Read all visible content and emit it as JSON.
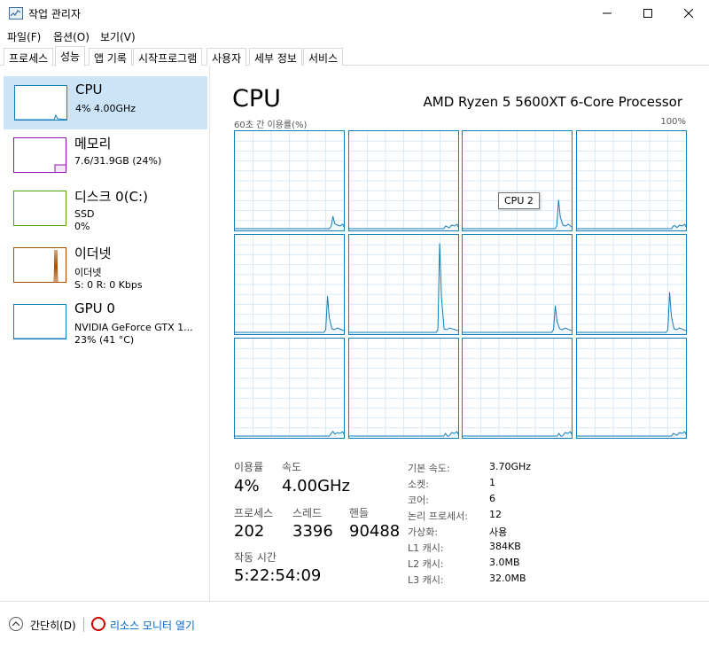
{
  "window": {
    "title": "작업 관리자"
  },
  "menu": [
    "파일(F)",
    "옵션(O)",
    "보기(V)"
  ],
  "tabs": [
    "프로세스",
    "성능",
    "앱 기록",
    "시작프로그램",
    "사용자",
    "세부 정보",
    "서비스"
  ],
  "active_tab": "성능",
  "sidebar": {
    "items": [
      {
        "title": "CPU",
        "line1": "4% 4.00GHz",
        "line2": "",
        "color": "#117dbb",
        "selected": true
      },
      {
        "title": "메모리",
        "line1": "7.6/31.9GB (24%)",
        "line2": "",
        "color": "#8b12ae",
        "selected": false
      },
      {
        "title": "디스크 0(C:)",
        "line1": "SSD",
        "line2": "0%",
        "color": "#4da60c",
        "selected": false
      },
      {
        "title": "이더넷",
        "line1": "이더넷",
        "line2": "S: 0 R: 0 Kbps",
        "color": "#a74f01",
        "selected": false
      },
      {
        "title": "GPU 0",
        "line1": "NVIDIA GeForce GTX 1...",
        "line2": "23% (41 °C)",
        "color": "#117dbb",
        "selected": false
      }
    ]
  },
  "main": {
    "heading": "CPU",
    "model": "AMD Ryzen 5 5600XT 6-Core Processor",
    "graph_caption": "60초 간 이용률(%)",
    "graph_max": "100%",
    "tooltip": "CPU 2",
    "cores": [
      {
        "level": 0.13,
        "spike_pos": 0.9
      },
      {
        "level": 0.02,
        "spike_pos": 0.9
      },
      {
        "level": 0.3,
        "spike_pos": 0.88
      },
      {
        "level": 0.03,
        "spike_pos": 0.9
      },
      {
        "level": 0.38,
        "spike_pos": 0.85
      },
      {
        "level": 0.93,
        "spike_pos": 0.83
      },
      {
        "level": 0.28,
        "spike_pos": 0.85
      },
      {
        "level": 0.42,
        "spike_pos": 0.85
      },
      {
        "level": 0.05,
        "spike_pos": 0.9
      },
      {
        "level": 0.0,
        "spike_pos": 0.9
      },
      {
        "level": 0.0,
        "spike_pos": 0.9
      },
      {
        "level": 0.02,
        "spike_pos": 0.9
      }
    ],
    "stats": {
      "util_label": "이용률",
      "util_value": "4%",
      "speed_label": "속도",
      "speed_value": "4.00GHz",
      "proc_label": "프로세스",
      "proc_value": "202",
      "threads_label": "스레드",
      "threads_value": "3396",
      "handles_label": "핸들",
      "handles_value": "90488",
      "uptime_label": "작동 시간",
      "uptime_value": "5:22:54:09"
    },
    "specs": [
      {
        "label": "기본 속도:",
        "value": "3.70GHz"
      },
      {
        "label": "소켓:",
        "value": "1"
      },
      {
        "label": "코어:",
        "value": "6"
      },
      {
        "label": "논리 프로세서:",
        "value": "12"
      },
      {
        "label": "가상화:",
        "value": "사용"
      },
      {
        "label": "L1 캐시:",
        "value": "384KB"
      },
      {
        "label": "L2 캐시:",
        "value": "3.0MB"
      },
      {
        "label": "L3 캐시:",
        "value": "32.0MB"
      }
    ]
  },
  "footer": {
    "collapse_label": "간단히(D)",
    "monitor_label": "리소스 모니터 열기"
  }
}
